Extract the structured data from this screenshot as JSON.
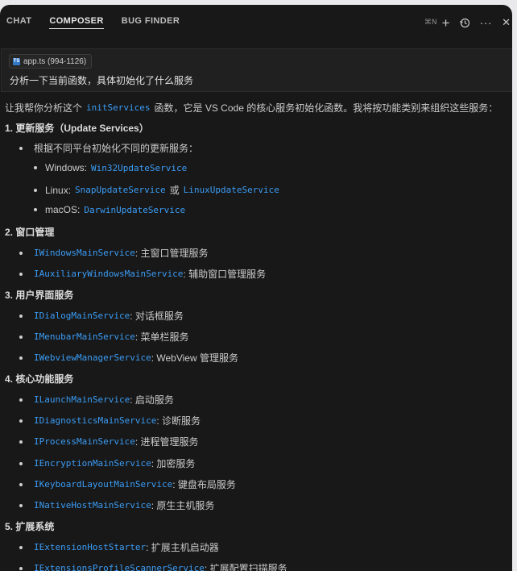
{
  "tabs": [
    {
      "label": "CHAT"
    },
    {
      "label": "COMPOSER"
    },
    {
      "label": "BUG FINDER"
    }
  ],
  "header_actions": {
    "shortcut": "⌘N",
    "new_icon": "plus-icon",
    "history_icon": "history-icon",
    "more_icon": "more-icon",
    "close_icon": "close-icon"
  },
  "context": {
    "file_chip": "app.ts (994-1126)",
    "question": "分析一下当前函数，具体初始化了什么服务"
  },
  "response": {
    "intro_before": "让我帮你分析这个",
    "intro_code": "initServices",
    "intro_after": "函数，它是 VS Code 的核心服务初始化函数。我将按功能类别来组织这些服务：",
    "s1": {
      "heading": "1. 更新服务（Update Services）",
      "sub": "根据不同平台初始化不同的更新服务：",
      "win_label": "Windows:",
      "win_code": "Win32UpdateService",
      "linux_label": "Linux:",
      "linux_code1": "SnapUpdateService",
      "linux_or": "或",
      "linux_code2": "LinuxUpdateService",
      "mac_label": "macOS:",
      "mac_code": "DarwinUpdateService"
    },
    "s2": {
      "heading": "2. 窗口管理",
      "items": [
        {
          "code": "IWindowsMainService",
          "desc": ": 主窗口管理服务"
        },
        {
          "code": "IAuxiliaryWindowsMainService",
          "desc": ": 辅助窗口管理服务"
        }
      ]
    },
    "s3": {
      "heading": "3. 用户界面服务",
      "items": [
        {
          "code": "IDialogMainService",
          "desc": ": 对话框服务"
        },
        {
          "code": "IMenubarMainService",
          "desc": ": 菜单栏服务"
        },
        {
          "code": "IWebviewManagerService",
          "desc": ": WebView 管理服务"
        }
      ]
    },
    "s4": {
      "heading": "4. 核心功能服务",
      "items": [
        {
          "code": "ILaunchMainService",
          "desc": ": 启动服务"
        },
        {
          "code": "IDiagnosticsMainService",
          "desc": ": 诊断服务"
        },
        {
          "code": "IProcessMainService",
          "desc": ": 进程管理服务"
        },
        {
          "code": "IEncryptionMainService",
          "desc": ": 加密服务"
        },
        {
          "code": "IKeyboardLayoutMainService",
          "desc": ": 键盘布局服务"
        },
        {
          "code": "INativeHostMainService",
          "desc": ": 原生主机服务"
        }
      ]
    },
    "s5": {
      "heading": "5. 扩展系统",
      "items": [
        {
          "code": "IExtensionHostStarter",
          "desc": ": 扩展主机启动器"
        },
        {
          "code": "IExtensionsProfileScannerService",
          "desc": ": 扩展配置扫描服务"
        }
      ]
    }
  }
}
